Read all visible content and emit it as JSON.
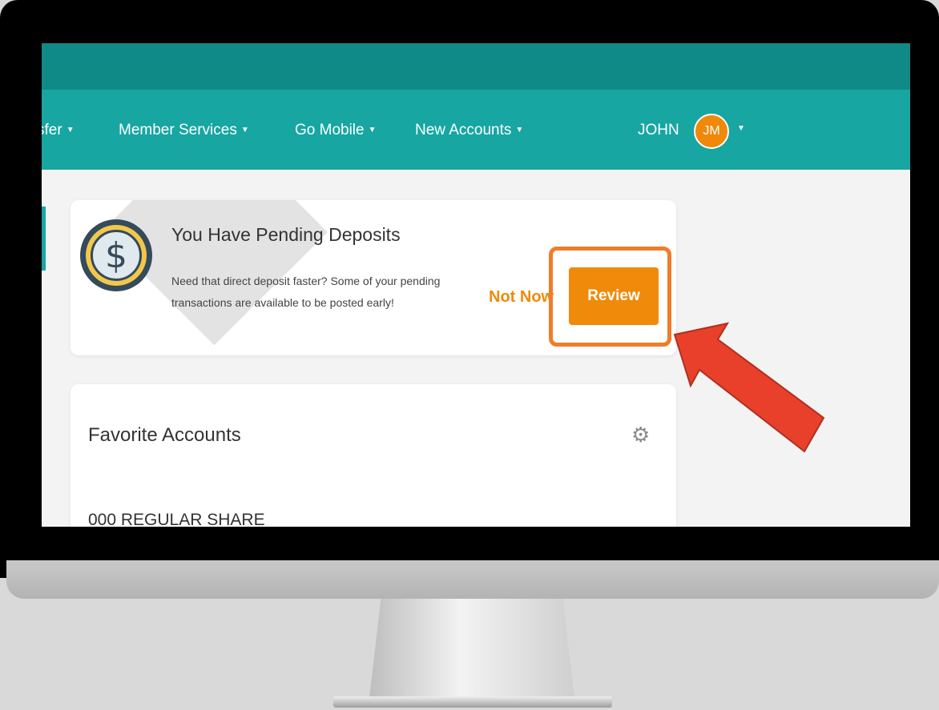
{
  "nav": {
    "items": [
      {
        "label": "sfer"
      },
      {
        "label": "Member Services"
      },
      {
        "label": "Go Mobile"
      },
      {
        "label": "New Accounts"
      }
    ],
    "user": {
      "name": "JOHN",
      "initials": "JM"
    }
  },
  "pending_deposits": {
    "title": "You Have Pending Deposits",
    "description_line1": "Need that direct deposit faster? Some of your pending",
    "description_line2": "transactions are available to be posted early!",
    "not_now_label": "Not Now",
    "review_label": "Review",
    "icon": "dollar-coin-icon",
    "highlight_color": "#ef7d29"
  },
  "favorite_accounts": {
    "title": "Favorite Accounts",
    "settings_icon": "gear-icon",
    "accounts": [
      {
        "name": "000 REGULAR SHARE"
      }
    ]
  },
  "annotation": {
    "arrow_color": "#e8402a",
    "arrow_icon": "arrow-pointer"
  },
  "colors": {
    "topbar": "#0f8a86",
    "navbar": "#17a6a2",
    "accent_orange": "#f08a0a"
  }
}
